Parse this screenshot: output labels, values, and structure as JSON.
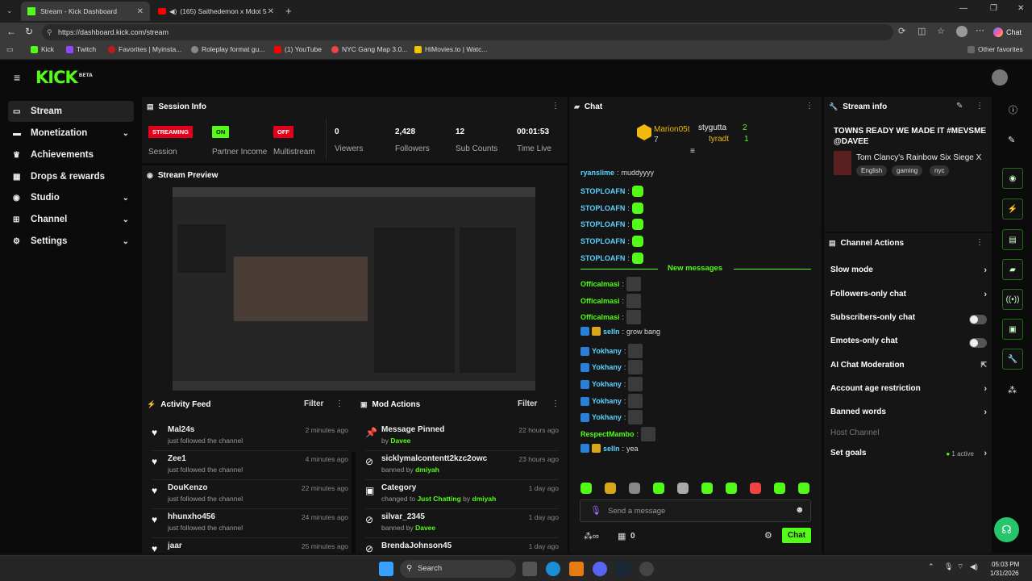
{
  "browser": {
    "tabs": [
      {
        "title": "Stream - Kick Dashboard"
      },
      {
        "title": "(165) Saithedemon x Mdot 5"
      }
    ],
    "url": "https://dashboard.kick.com/stream",
    "chat_button": "Chat",
    "bookmarks": [
      "Kick",
      "Twitch",
      "Favorites | Myinsta...",
      "Roleplay format gu...",
      "(1) YouTube",
      "NYC Gang Map 3.0...",
      "HiMovies.to | Watc..."
    ],
    "other_favorites": "Other favorites"
  },
  "app": {
    "logo": "KICK",
    "logo_tag": "BETA"
  },
  "sidebar": {
    "items": [
      {
        "label": "Stream"
      },
      {
        "label": "Monetization"
      },
      {
        "label": "Achievements"
      },
      {
        "label": "Drops & rewards"
      },
      {
        "label": "Studio"
      },
      {
        "label": "Channel"
      },
      {
        "label": "Settings"
      }
    ]
  },
  "session": {
    "title": "Session Info",
    "streaming_badge": "STREAMING",
    "streaming_label": "Session",
    "partner_badge": "ON",
    "partner_label": "Partner Income",
    "multistream_badge": "OFF",
    "multistream_label": "Multistream",
    "viewers": "0",
    "viewers_label": "Viewers",
    "followers": "2,428",
    "followers_label": "Followers",
    "subs": "12",
    "subs_label": "Sub Counts",
    "time": "00:01:53",
    "time_label": "Time Live"
  },
  "preview": {
    "title": "Stream Preview"
  },
  "activity": {
    "title": "Activity Feed",
    "filter": "Filter",
    "items": [
      {
        "name": "Mal24s",
        "sub": "just followed the channel",
        "time": "2 minutes ago"
      },
      {
        "name": "Zee1",
        "sub": "just followed the channel",
        "time": "4 minutes ago"
      },
      {
        "name": "DouKenzo",
        "sub": "just followed the channel",
        "time": "22 minutes ago"
      },
      {
        "name": "hhunxho456",
        "sub": "just followed the channel",
        "time": "24 minutes ago"
      },
      {
        "name": "jaar",
        "sub": "",
        "time": "25 minutes ago"
      }
    ]
  },
  "mod": {
    "title": "Mod Actions",
    "filter": "Filter",
    "items": [
      {
        "name": "Message Pinned",
        "pre": "by",
        "user": "Davee",
        "time": "22 hours ago"
      },
      {
        "name": "sicklymalcontentt2kzc2owc",
        "pre": "banned by",
        "user": "dmiyah",
        "time": "23 hours ago"
      },
      {
        "name": "Category",
        "pre": "changed to",
        "user": "Just Chatting",
        "pre2": "by",
        "user2": "dmiyah",
        "time": "1 day ago"
      },
      {
        "name": "silvar_2345",
        "pre": "banned by",
        "user": "Davee",
        "time": "1 day ago"
      },
      {
        "name": "BrendaJohnson45",
        "pre": "",
        "user": "",
        "time": "1 day ago"
      }
    ]
  },
  "chat": {
    "title": "Chat",
    "top_gifters": [
      {
        "name": "Marion05t",
        "count": "7"
      },
      {
        "name": "stygutta",
        "count": "2"
      },
      {
        "name": "tyradt",
        "count": "1"
      }
    ],
    "messages": [
      {
        "user": "ryanslime",
        "text": "muddyyyy",
        "color": "#5ad3ff"
      },
      {
        "user": "STOPLOAFN",
        "text": "",
        "color": "#5ad3ff"
      },
      {
        "user": "STOPLOAFN",
        "text": "",
        "color": "#5ad3ff"
      },
      {
        "user": "STOPLOAFN",
        "text": "",
        "color": "#5ad3ff"
      },
      {
        "user": "STOPLOAFN",
        "text": "",
        "color": "#5ad3ff"
      },
      {
        "user": "STOPLOAFN",
        "text": "",
        "color": "#5ad3ff"
      }
    ],
    "new_messages": "New messages",
    "messages2": [
      {
        "user": "Officalmasi",
        "text": "",
        "color": "#53fc18"
      },
      {
        "user": "Officalmasi",
        "text": "",
        "color": "#53fc18"
      },
      {
        "user": "Officalmasi",
        "text": "",
        "color": "#53fc18"
      },
      {
        "user": "selln",
        "text": "grow bang",
        "color": "#5ad3ff"
      },
      {
        "user": "Yokhany",
        "text": "",
        "color": "#5ad3ff"
      },
      {
        "user": "Yokhany",
        "text": "",
        "color": "#5ad3ff"
      },
      {
        "user": "Yokhany",
        "text": "",
        "color": "#5ad3ff"
      },
      {
        "user": "Yokhany",
        "text": "",
        "color": "#5ad3ff"
      },
      {
        "user": "Yokhany",
        "text": "",
        "color": "#5ad3ff"
      },
      {
        "user": "RespectMambo",
        "text": "",
        "color": "#53fc18"
      },
      {
        "user": "selln",
        "text": "yea",
        "color": "#5ad3ff"
      }
    ],
    "placeholder": "Send a message",
    "points": "0",
    "send": "Chat"
  },
  "stream_info": {
    "title": "Stream info",
    "stream_title": "TOWNS READY WE MADE IT #MEVSME @DAVEE",
    "game": "Tom Clancy's Rainbow Six Siege X",
    "tags": [
      "English",
      "gaming",
      "nyc"
    ]
  },
  "channel_actions": {
    "title": "Channel Actions",
    "items": [
      {
        "label": "Slow mode"
      },
      {
        "label": "Followers-only chat"
      },
      {
        "label": "Subscribers-only chat"
      },
      {
        "label": "Emotes-only chat"
      },
      {
        "label": "AI Chat Moderation"
      },
      {
        "label": "Account age restriction"
      },
      {
        "label": "Banned words"
      },
      {
        "label": "Host Channel"
      },
      {
        "label": "Set goals"
      }
    ],
    "goals_active": "1 active"
  },
  "taskbar": {
    "search": "Search",
    "time": "05:03 PM",
    "date": "1/31/2026"
  },
  "colors": {
    "accent": "#53fc18",
    "red": "#e3001b"
  }
}
